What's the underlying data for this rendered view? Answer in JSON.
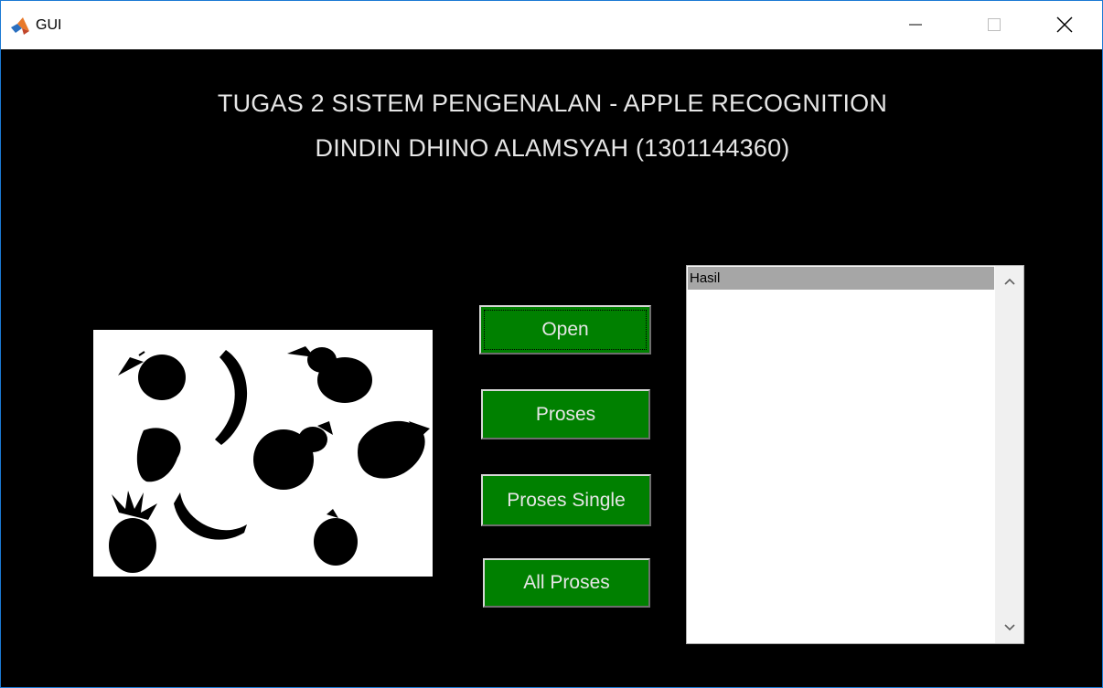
{
  "window": {
    "title": "GUI",
    "icon": "matlab-icon",
    "controls": [
      "minimize-icon",
      "maximize-icon",
      "close-icon"
    ]
  },
  "header": {
    "line1": "TUGAS 2 SISTEM PENGENALAN - APPLE RECOGNITION",
    "line2": "DINDIN DHINO ALAMSYAH (1301144360)"
  },
  "buttons": {
    "open": "Open",
    "proses": "Proses",
    "proses_single": "Proses Single",
    "all_proses": "All Proses"
  },
  "listbox": {
    "items": [
      "Hasil"
    ],
    "selected_index": 0
  },
  "image_panel": {
    "content": "binary fruit silhouettes",
    "icon": "fruit-image"
  },
  "colors": {
    "background": "#000000",
    "button": "#008000",
    "heading_text": "#e6e6e6",
    "selected_item": "#a6a6a6"
  }
}
